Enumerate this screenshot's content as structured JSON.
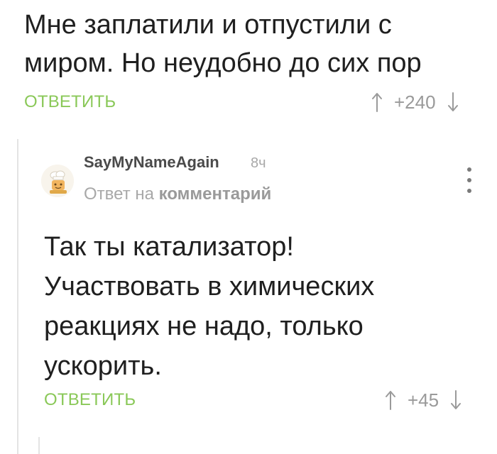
{
  "parent": {
    "lines": [
      "Мне заплатили и отпустили с",
      "миром. Но неудобно до сих пор"
    ],
    "reply_label": "ОТВЕТИТЬ",
    "rating": "+240",
    "icons": {
      "up": "arrow-up-icon",
      "down": "arrow-down-icon"
    }
  },
  "reply": {
    "author": "SayMyNameAgain",
    "time": "8ч",
    "reply_prefix": "Ответ на",
    "reply_link": "комментарий",
    "lines": [
      "Так ты катализатор!",
      "Участвовать в химических",
      "реакциях не надо, только",
      "ускорить."
    ],
    "reply_label": "ОТВЕТИТЬ",
    "rating": "+45",
    "icons": {
      "avatar": "chef-avatar",
      "menu": "more-vertical-icon"
    }
  },
  "colors": {
    "accent": "#8ac858",
    "muted": "#9a9a9a",
    "text": "#1f1f1f",
    "thread": "#e4e4e4"
  }
}
